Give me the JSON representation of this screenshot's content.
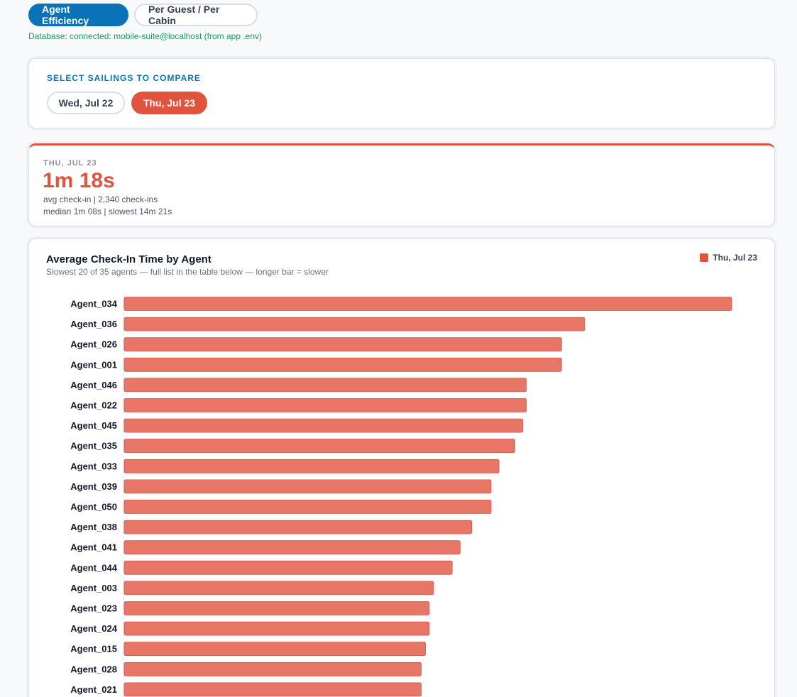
{
  "tabs": [
    {
      "label": "Agent Efficiency",
      "active": true
    },
    {
      "label": "Per Guest / Per Cabin",
      "active": false
    }
  ],
  "db_status": "Database: connected: mobile-suite@localhost (from app .env)",
  "select_sailings": {
    "title": "SELECT SAILINGS TO COMPARE",
    "options": [
      {
        "label": "Wed, Jul 22",
        "selected": false
      },
      {
        "label": "Thu, Jul 23",
        "selected": true
      }
    ]
  },
  "summary": {
    "date": "THU, JUL 23",
    "value": "1m 18s",
    "line1": "avg check-in  |  2,340 check-ins",
    "line2": "median 1m 08s  |  slowest 14m 21s",
    "accent_color": "#e0533d"
  },
  "chart": {
    "title": "Average Check-In Time by Agent",
    "subtitle": "Slowest 20 of 35 agents — full list in the table below — longer bar = slower",
    "legend_label": "Thu, Jul 23"
  },
  "chart_data": {
    "type": "bar",
    "orientation": "horizontal",
    "categories": [
      "Agent_034",
      "Agent_036",
      "Agent_026",
      "Agent_001",
      "Agent_046",
      "Agent_022",
      "Agent_045",
      "Agent_035",
      "Agent_033",
      "Agent_039",
      "Agent_050",
      "Agent_038",
      "Agent_041",
      "Agent_044",
      "Agent_003",
      "Agent_023",
      "Agent_024",
      "Agent_015",
      "Agent_028",
      "Agent_021"
    ],
    "series": [
      {
        "name": "Thu, Jul 23",
        "color": "#e87666",
        "values": [
          100,
          75.8,
          72,
          72,
          66.2,
          66.2,
          65.6,
          64.3,
          61.7,
          60.4,
          60.4,
          57.2,
          55.3,
          54,
          50.9,
          50.2,
          50.2,
          49.6,
          48.9,
          48.9
        ]
      }
    ],
    "xlim": [
      0,
      100
    ]
  }
}
